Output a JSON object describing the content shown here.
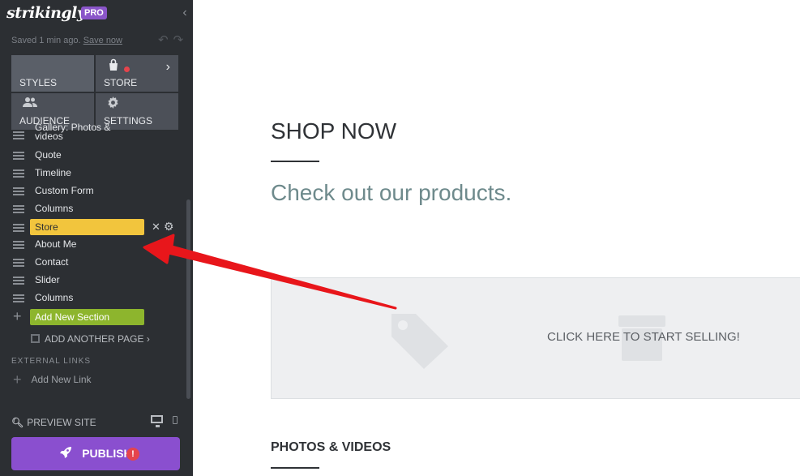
{
  "brand": {
    "logo": "strikingly",
    "badge": "PRO"
  },
  "save_status": {
    "text": "Saved 1 min ago.",
    "link": "Save now"
  },
  "tabs": [
    {
      "label": "STYLES",
      "icon": "palette-icon"
    },
    {
      "label": "STORE",
      "icon": "shopping-bag-icon"
    },
    {
      "label": "AUDIENCE",
      "icon": "people-icon"
    },
    {
      "label": "SETTINGS",
      "icon": "gear-icon"
    }
  ],
  "sections": [
    "Gallery: Photos & videos",
    "Quote",
    "Timeline",
    "Custom Form",
    "Columns",
    "Store",
    "About Me",
    "Contact",
    "Slider",
    "Columns"
  ],
  "add_section_label": "Add New Section",
  "add_page_label": "ADD ANOTHER PAGE",
  "external_links": {
    "heading": "EXTERNAL LINKS",
    "add_label": "Add New Link"
  },
  "footer": {
    "preview_label": "PREVIEW SITE",
    "publish_label": "PUBLISH",
    "alert_glyph": "!"
  },
  "main": {
    "shop_title": "SHOP NOW",
    "subtitle": "Check out our products.",
    "store_cta": "CLICK HERE TO START SELLING!",
    "photos_title": "PHOTOS & VIDEOS"
  },
  "colors": {
    "sidebar_bg": "#2c2f33",
    "selected_section": "#f2c53d",
    "add_section": "#8db52d",
    "publish": "#8a4fcf",
    "annotation_arrow": "#e8161b"
  }
}
